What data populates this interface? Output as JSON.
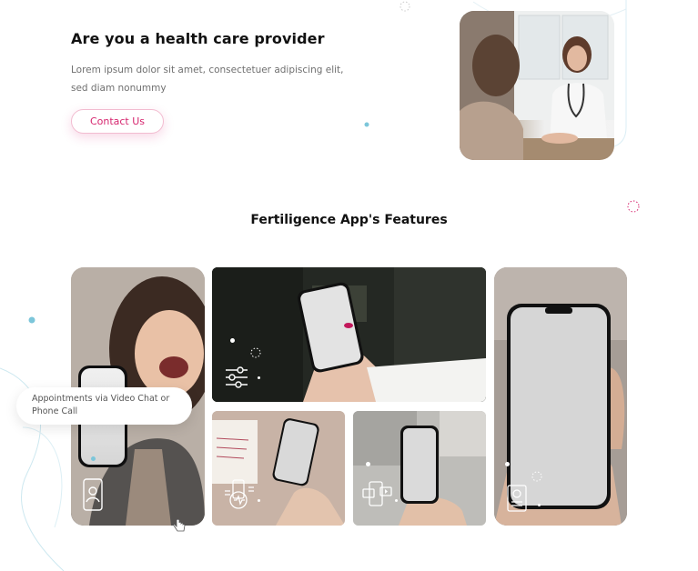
{
  "hero": {
    "title": "Are you a health care provider",
    "body": "Lorem ipsum dolor sit amet, consectetuer adipiscing elit, sed diam nonummy",
    "button_label": "Contact Us"
  },
  "features": {
    "section_title": "Fertiligence App's Features",
    "tooltip": "Appointments via Video Chat or Phone Call",
    "cards": [
      {
        "icon": "contact-phone-icon"
      },
      {
        "icon": "sliders-icon"
      },
      {
        "icon": "health-tracking-icon"
      },
      {
        "icon": "video-chat-icon"
      },
      {
        "icon": "medical-record-icon"
      }
    ]
  },
  "colors": {
    "accent": "#d6256e",
    "title": "#111111",
    "body": "#6f6f6f",
    "deco_blue": "#7cc6da"
  }
}
